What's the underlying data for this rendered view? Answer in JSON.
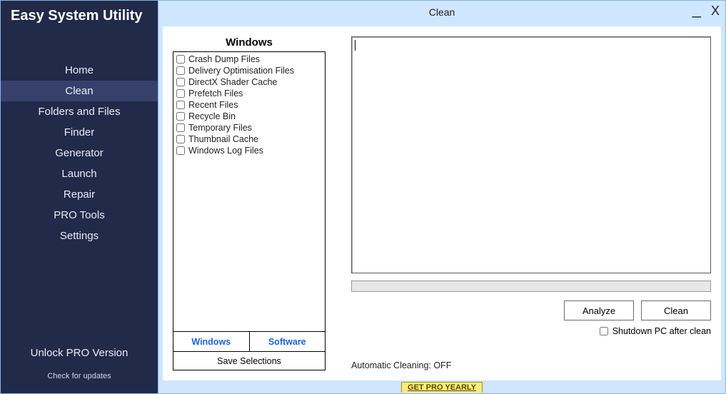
{
  "app": {
    "title": "Easy System Utility"
  },
  "titlebar": {
    "title": "Clean"
  },
  "sidebar": {
    "items": [
      "Home",
      "Clean",
      "Folders and Files",
      "Finder",
      "Generator",
      "Launch",
      "Repair",
      "PRO Tools",
      "Settings"
    ],
    "active_index": 1,
    "unlock_label": "Unlock PRO Version",
    "check_updates_label": "Check for updates"
  },
  "clean": {
    "category_header": "Windows",
    "items": [
      {
        "label": "Crash Dump Files",
        "checked": false
      },
      {
        "label": "Delivery Optimisation Files",
        "checked": false
      },
      {
        "label": "DirectX Shader Cache",
        "checked": false
      },
      {
        "label": "Prefetch Files",
        "checked": false
      },
      {
        "label": "Recent Files",
        "checked": false
      },
      {
        "label": "Recycle Bin",
        "checked": false
      },
      {
        "label": "Temporary Files",
        "checked": false
      },
      {
        "label": "Thumbnail Cache",
        "checked": false
      },
      {
        "label": "Windows Log Files",
        "checked": false
      }
    ],
    "tabs": [
      "Windows",
      "Software"
    ],
    "active_tab_index": 0,
    "save_selections_label": "Save Selections",
    "analyze_label": "Analyze",
    "clean_label": "Clean",
    "shutdown_label": "Shutdown PC after clean",
    "shutdown_checked": false,
    "auto_cleaning_label": "Automatic Cleaning: OFF",
    "output_text": ""
  },
  "promo": {
    "label": "GET PRO YEARLY"
  }
}
